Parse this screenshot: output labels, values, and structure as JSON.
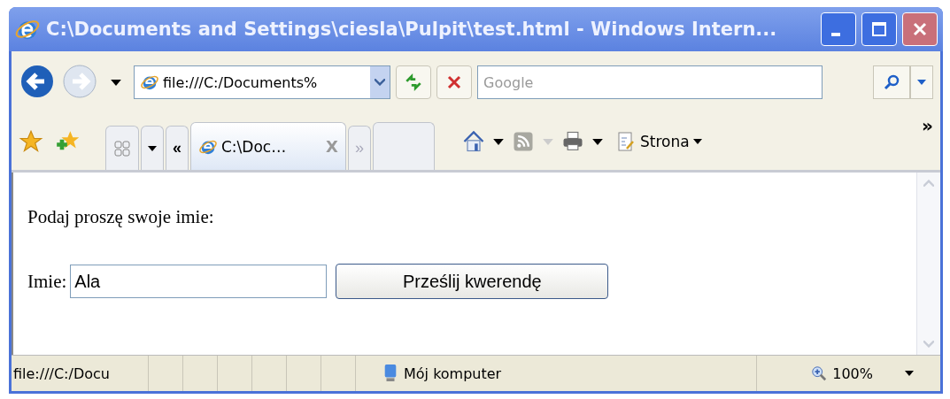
{
  "window": {
    "title": "C:\\Documents and Settings\\ciesla\\Pulpit\\test.html - Windows Intern..."
  },
  "address_bar": {
    "value": "file:///C:/Documents%"
  },
  "search": {
    "placeholder": "Google"
  },
  "tab_nav": {
    "back": "«",
    "forward": "»"
  },
  "tabs": [
    {
      "label": "C:\\Doc…",
      "selected": true,
      "close": "X"
    },
    {
      "selected": false
    }
  ],
  "command_bar": {
    "page_menu": "Strona",
    "overflow": "»"
  },
  "page": {
    "prompt": "Podaj proszę swoje imie:",
    "field_label": "Imie:",
    "name_value": "Ala",
    "submit": "Prześlij kwerendę"
  },
  "status_bar": {
    "url": "file:///C:/Docu",
    "zone": "Mój komputer",
    "zoom": "100%"
  }
}
